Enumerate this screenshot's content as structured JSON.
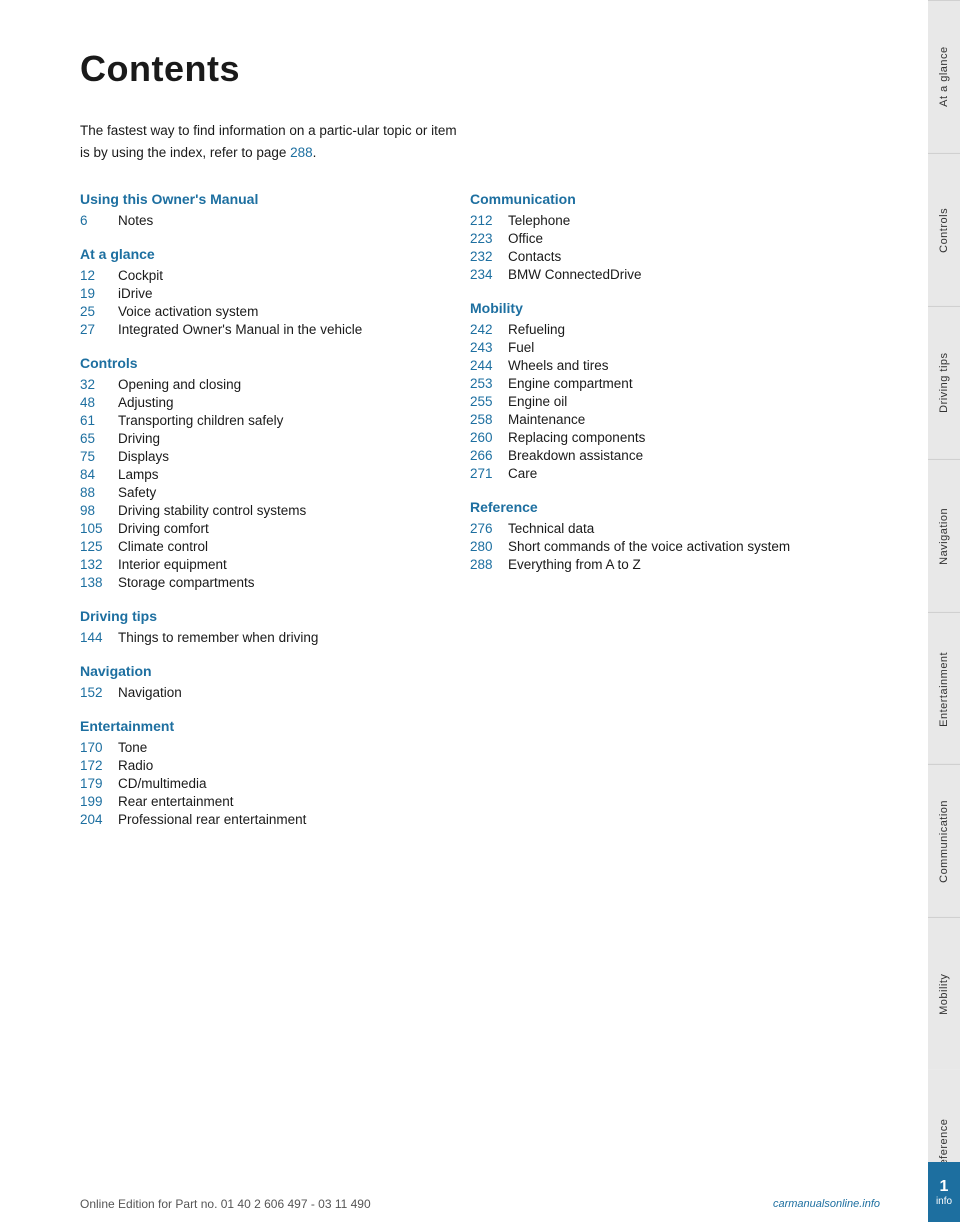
{
  "page": {
    "title": "Contents"
  },
  "intro": {
    "text1": "The fastest way to find information on a partic-ular topic or item is by using the index, refer to page ",
    "link": "288",
    "text2": "."
  },
  "left_col": {
    "sections": [
      {
        "heading": "Using this Owner's Manual",
        "items": [
          {
            "num": "6",
            "label": "Notes"
          }
        ]
      },
      {
        "heading": "At a glance",
        "items": [
          {
            "num": "12",
            "label": "Cockpit"
          },
          {
            "num": "19",
            "label": "iDrive"
          },
          {
            "num": "25",
            "label": "Voice activation system"
          },
          {
            "num": "27",
            "label": "Integrated Owner's Manual in the vehicle"
          }
        ]
      },
      {
        "heading": "Controls",
        "items": [
          {
            "num": "32",
            "label": "Opening and closing"
          },
          {
            "num": "48",
            "label": "Adjusting"
          },
          {
            "num": "61",
            "label": "Transporting children safely"
          },
          {
            "num": "65",
            "label": "Driving"
          },
          {
            "num": "75",
            "label": "Displays"
          },
          {
            "num": "84",
            "label": "Lamps"
          },
          {
            "num": "88",
            "label": "Safety"
          },
          {
            "num": "98",
            "label": "Driving stability control systems"
          },
          {
            "num": "105",
            "label": "Driving comfort"
          },
          {
            "num": "125",
            "label": "Climate control"
          },
          {
            "num": "132",
            "label": "Interior equipment"
          },
          {
            "num": "138",
            "label": "Storage compartments"
          }
        ]
      },
      {
        "heading": "Driving tips",
        "items": [
          {
            "num": "144",
            "label": "Things to remember when driving"
          }
        ]
      },
      {
        "heading": "Navigation",
        "items": [
          {
            "num": "152",
            "label": "Navigation"
          }
        ]
      },
      {
        "heading": "Entertainment",
        "items": [
          {
            "num": "170",
            "label": "Tone"
          },
          {
            "num": "172",
            "label": "Radio"
          },
          {
            "num": "179",
            "label": "CD/multimedia"
          },
          {
            "num": "199",
            "label": "Rear entertainment"
          },
          {
            "num": "204",
            "label": "Professional rear entertainment"
          }
        ]
      }
    ]
  },
  "right_col": {
    "sections": [
      {
        "heading": "Communication",
        "items": [
          {
            "num": "212",
            "label": "Telephone"
          },
          {
            "num": "223",
            "label": "Office"
          },
          {
            "num": "232",
            "label": "Contacts"
          },
          {
            "num": "234",
            "label": "BMW ConnectedDrive"
          }
        ]
      },
      {
        "heading": "Mobility",
        "items": [
          {
            "num": "242",
            "label": "Refueling"
          },
          {
            "num": "243",
            "label": "Fuel"
          },
          {
            "num": "244",
            "label": "Wheels and tires"
          },
          {
            "num": "253",
            "label": "Engine compartment"
          },
          {
            "num": "255",
            "label": "Engine oil"
          },
          {
            "num": "258",
            "label": "Maintenance"
          },
          {
            "num": "260",
            "label": "Replacing components"
          },
          {
            "num": "266",
            "label": "Breakdown assistance"
          },
          {
            "num": "271",
            "label": "Care"
          }
        ]
      },
      {
        "heading": "Reference",
        "items": [
          {
            "num": "276",
            "label": "Technical data"
          },
          {
            "num": "280",
            "label": "Short commands of the voice activation system"
          },
          {
            "num": "288",
            "label": "Everything from A to Z"
          }
        ]
      }
    ]
  },
  "sidebar": {
    "tabs": [
      {
        "label": "At a glance",
        "active": false
      },
      {
        "label": "Controls",
        "active": false
      },
      {
        "label": "Driving tips",
        "active": false
      },
      {
        "label": "Navigation",
        "active": false
      },
      {
        "label": "Entertainment",
        "active": false
      },
      {
        "label": "Communication",
        "active": false
      },
      {
        "label": "Mobility",
        "active": false
      },
      {
        "label": "Reference",
        "active": false
      }
    ]
  },
  "footer": {
    "center_text": "Online Edition for Part no. 01 40 2 606 497 - 03 11 490",
    "watermark": "carmanualsonline.info"
  },
  "info_badge": {
    "num": "1",
    "label": "info"
  }
}
